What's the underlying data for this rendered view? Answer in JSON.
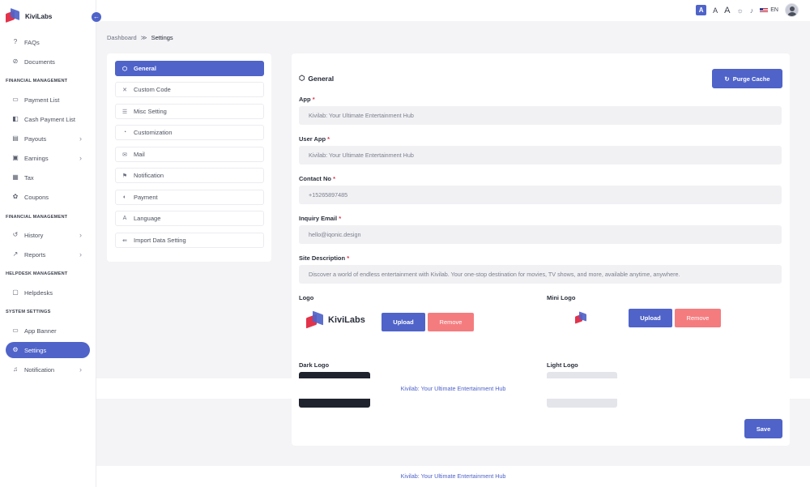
{
  "brand": {
    "name": "KiviLabs"
  },
  "sidebar": {
    "items": [
      {
        "label": "FAQs",
        "icon": "help-circle-icon"
      },
      {
        "label": "Documents",
        "icon": "paperclip-icon"
      },
      {
        "section": "FINANCIAL MANAGEMENT"
      },
      {
        "label": "Payment List",
        "icon": "credit-card-icon"
      },
      {
        "label": "Cash Payment List",
        "icon": "cash-icon"
      },
      {
        "label": "Payouts",
        "icon": "wallet-icon",
        "chevron": true
      },
      {
        "label": "Earnings",
        "icon": "briefcase-icon",
        "chevron": true
      },
      {
        "label": "Tax",
        "icon": "calculator-icon"
      },
      {
        "label": "Coupons",
        "icon": "gift-icon"
      },
      {
        "section": "FINANCIAL MANAGEMENT"
      },
      {
        "label": "History",
        "icon": "history-icon",
        "chevron": true
      },
      {
        "label": "Reports",
        "icon": "chart-icon",
        "chevron": true
      },
      {
        "section": "HELPDESK MANAGEMENT"
      },
      {
        "label": "Helpdesks",
        "icon": "message-icon"
      },
      {
        "section": "SYSTEM SETTINGS"
      },
      {
        "label": "App Banner",
        "icon": "image-icon"
      },
      {
        "label": "Settings",
        "icon": "gear-icon",
        "active": true
      },
      {
        "label": "Notification",
        "icon": "bell-icon",
        "chevron": true
      }
    ]
  },
  "topbar": {
    "font_sizes": [
      "A",
      "A",
      "A"
    ],
    "language": "EN"
  },
  "breadcrumb": {
    "parent": "Dashboard",
    "separator": "≫",
    "current": "Settings"
  },
  "settings_menu": {
    "items": [
      {
        "label": "General",
        "icon": "box-icon",
        "active": true
      },
      {
        "label": "Custom Code",
        "icon": "code-icon"
      },
      {
        "label": "Misc Setting",
        "icon": "sliders-icon"
      },
      {
        "label": "Customization",
        "icon": "palette-icon"
      },
      {
        "label": "Mail",
        "icon": "mail-icon"
      },
      {
        "label": "Notification",
        "icon": "bell-icon"
      },
      {
        "label": "Payment",
        "icon": "coin-icon"
      },
      {
        "label": "Language",
        "icon": "translate-icon"
      },
      {
        "label": "Import Data Setting",
        "icon": "import-icon"
      }
    ]
  },
  "form": {
    "title": "General",
    "purge_label": "Purge Cache",
    "fields": [
      {
        "label": "App",
        "value": "Kivilab: Your Ultimate Entertainment Hub"
      },
      {
        "label": "User App",
        "value": "Kivilab: Your Ultimate Entertainment Hub"
      },
      {
        "label": "Contact No",
        "value": "+15265897485"
      },
      {
        "label": "Inquiry Email",
        "value": "hello@iqonic.design"
      },
      {
        "label": "Site Description",
        "value": "Discover a world of endless entertainment with Kivilab. Your one-stop destination for movies, TV shows, and more, available anytime, anywhere."
      }
    ],
    "required_mark": "*",
    "logo_label": "Logo",
    "mini_logo_label": "Mini Logo",
    "dark_logo_label": "Dark Logo",
    "light_logo_label": "Light Logo",
    "upload_label": "Upload",
    "remove_label": "Remove",
    "save_label": "Save",
    "logo_text": "KiviLabs"
  },
  "footer": {
    "text": "Kivilab: Your Ultimate Entertainment Hub"
  },
  "colors": {
    "accent": "#4f63c9",
    "danger": "#f47c7f",
    "required": "#e2334a"
  }
}
